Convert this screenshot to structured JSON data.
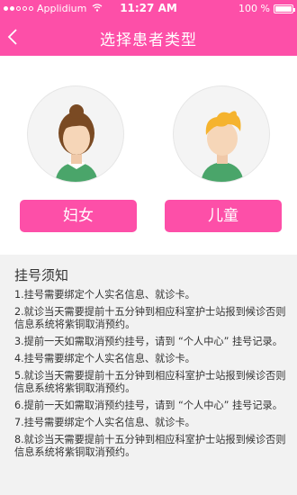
{
  "status_bar": {
    "carrier": "Applidium",
    "time": "11:27 AM",
    "battery": "100 %",
    "battery_level": 1.0
  },
  "nav": {
    "title": "选择患者类型",
    "back_icon": "chevron-left-icon"
  },
  "patient_types": [
    {
      "label": "妇女",
      "avatar": "woman-avatar"
    },
    {
      "label": "儿童",
      "avatar": "child-avatar"
    }
  ],
  "notice": {
    "title": "挂号须知",
    "items": [
      "1.挂号需要绑定个人实名信息、就诊卡。",
      "2.就诊当天需要提前十五分钟到相应科室护士站报到候诊否则信息系统将紫铜取消预约。",
      "3.提前一天如需取消预约挂号，请到 “个人中心” 挂号记录。",
      "4.挂号需要绑定个人实名信息、就诊卡。",
      "5.就诊当天需要提前十五分钟到相应科室护士站报到候诊否则信息系统将紫铜取消预约。",
      "6.提前一天如需取消预约挂号，请到 “个人中心” 挂号记录。",
      "7.挂号需要绑定个人实名信息、就诊卡。",
      "8.就诊当天需要提前十五分钟到相应科室护士站报到候诊否则信息系统将紫铜取消预约。"
    ]
  },
  "colors": {
    "accent": "#fd4fa8",
    "notice_bg": "#f2f2f2"
  }
}
